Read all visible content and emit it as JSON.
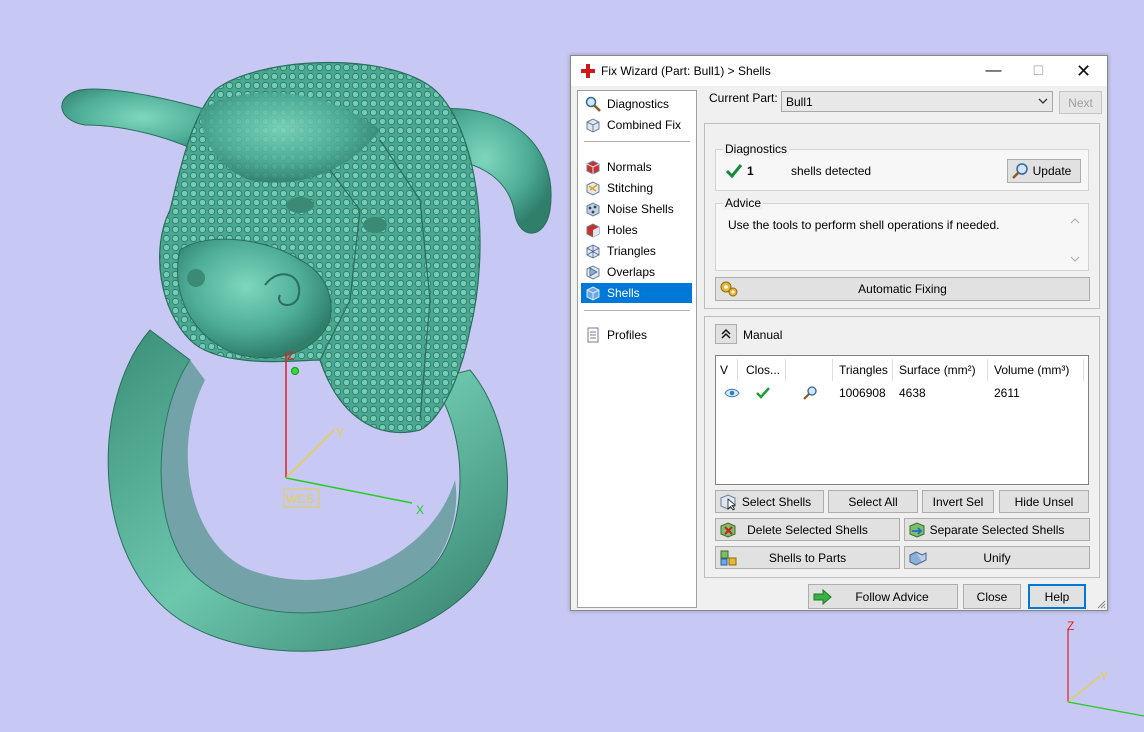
{
  "viewport": {
    "main_axes": {
      "z": "Z",
      "y": "Y",
      "x": "X",
      "origin": "WCS"
    },
    "corner_axes": {
      "z": "Z",
      "y": "Y"
    }
  },
  "dialog": {
    "title": "Fix Wizard (Part: Bull1) > Shells",
    "window_controls": {
      "minimize": "—",
      "maximize": "☐",
      "close": "✕"
    },
    "nav": {
      "items": [
        {
          "label": "Diagnostics",
          "icon": "magnifier-icon"
        },
        {
          "label": "Combined Fix",
          "icon": "cube-icon"
        },
        {
          "label": "Normals",
          "icon": "normals-icon"
        },
        {
          "label": "Stitching",
          "icon": "stitching-icon"
        },
        {
          "label": "Noise Shells",
          "icon": "noise-shells-icon"
        },
        {
          "label": "Holes",
          "icon": "holes-icon"
        },
        {
          "label": "Triangles",
          "icon": "triangles-icon"
        },
        {
          "label": "Overlaps",
          "icon": "overlaps-icon"
        },
        {
          "label": "Shells",
          "icon": "shells-icon",
          "selected": true
        },
        {
          "label": "Profiles",
          "icon": "profiles-icon"
        }
      ]
    },
    "current_part": {
      "label": "Current Part:",
      "value": "Bull1"
    },
    "next_label": "Next",
    "diagnostics": {
      "title": "Diagnostics",
      "count": "1",
      "message": "shells detected",
      "update_label": "Update"
    },
    "advice": {
      "title": "Advice",
      "text": "Use the tools to perform shell operations if needed."
    },
    "automatic_fixing_label": "Automatic Fixing",
    "manual": {
      "toggle": "«",
      "title": "Manual",
      "table": {
        "columns": [
          "V",
          "Clos...",
          "",
          "Triangles",
          "Surface (mm²)",
          "Volume (mm³)"
        ],
        "rows": [
          {
            "triangles": "1006908",
            "surface": "4638",
            "volume": "2611"
          }
        ]
      },
      "buttons": {
        "select_shells": "Select Shells",
        "select_all": "Select All",
        "invert_sel": "Invert Sel",
        "hide_unsel": "Hide Unsel",
        "delete_selected": "Delete Selected Shells",
        "separate_selected": "Separate Selected Shells",
        "shells_to_parts": "Shells to Parts",
        "unify": "Unify"
      }
    },
    "footer": {
      "follow_advice": "Follow Advice",
      "close": "Close",
      "help": "Help"
    }
  },
  "colors": {
    "background": "#c8c8f4",
    "model": "#4fae98",
    "selection": "#0078d7",
    "axis_x": "#22cc22",
    "axis_y": "#e8d040",
    "axis_z": "#e02020"
  }
}
